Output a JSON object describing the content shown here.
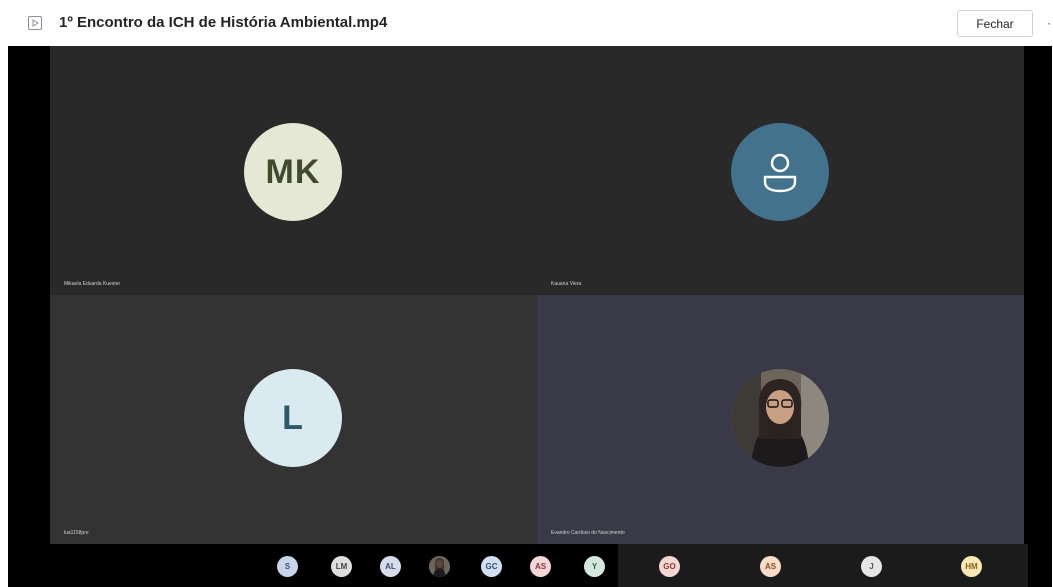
{
  "window": {
    "title": "1º Encontro da ICH de História Ambiental.mp4",
    "close_label": "Fechar",
    "more_glyph": "·",
    "file_icon": "play-file-icon"
  },
  "tiles": [
    {
      "name": "Mikaela Eduarda Kuester",
      "initials": "MK",
      "kind": "initials"
    },
    {
      "name": "Kauana Viera",
      "initials": "",
      "kind": "generic-person-icon"
    },
    {
      "name": "lua1158pre",
      "initials": "L",
      "kind": "initials"
    },
    {
      "name": "Evandro Cardoso do Nascimento",
      "initials": "",
      "kind": "photo"
    }
  ],
  "participants_strip": [
    {
      "initials": "S"
    },
    {
      "initials": "LM"
    },
    {
      "initials": "AL"
    },
    {
      "initials": "",
      "kind": "photo"
    },
    {
      "initials": "GC"
    },
    {
      "initials": "AS"
    },
    {
      "initials": "Y"
    },
    {
      "initials": "GO"
    },
    {
      "initials": "AS"
    },
    {
      "initials": "J"
    },
    {
      "initials": "HM"
    }
  ],
  "colors": {
    "mk_avatar_bg": "#e6e8d6",
    "mk_avatar_text": "#404a2c",
    "kauana_avatar_bg": "#43728c",
    "l_avatar_bg": "#d9eaf1",
    "l_avatar_text": "#2e5868",
    "tile_dark": "#292929",
    "tile_gray": "#333333",
    "tile_purple": "#3a3947"
  }
}
